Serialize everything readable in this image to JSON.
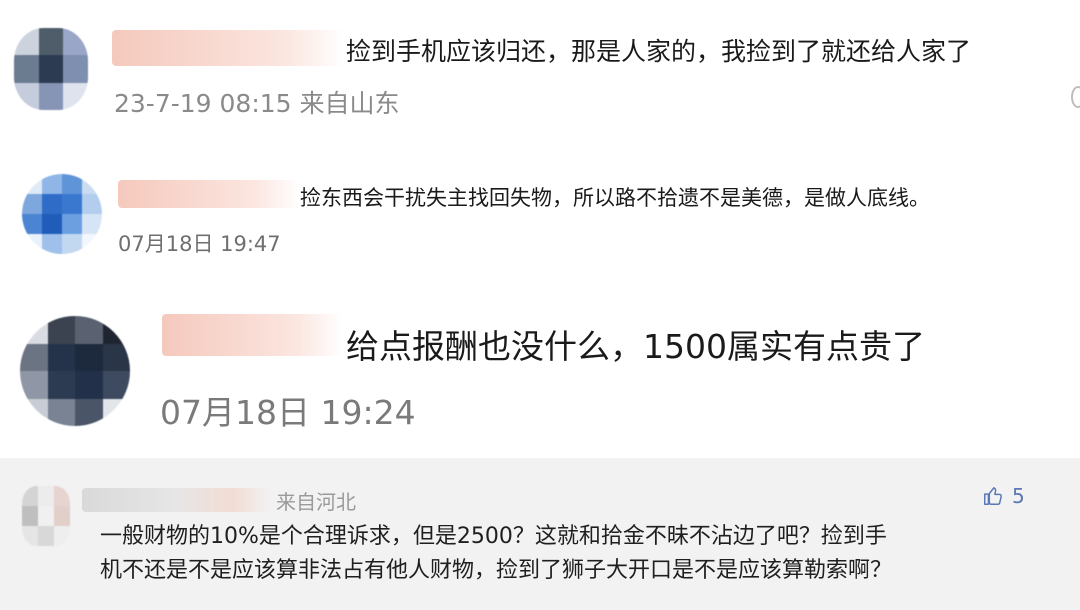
{
  "comments": [
    {
      "text": "捡到手机应该归还，那是人家的，我捡到了就还给人家了",
      "meta": "23-7-19 08:15 来自山东",
      "avatar_colors": [
        "#cdd3dc",
        "#4f5d6b",
        "#9aa6c8",
        "#6c7c90",
        "#2d3b52",
        "#7f8fb0",
        "#c5ccdc",
        "#8694b6",
        "#dfe3ee"
      ]
    },
    {
      "text": "捡东西会干扰失主找回失物，所以路不拾遗不是美德，是做人底线。",
      "meta": "07月18日 19:47",
      "avatar_colors": [
        "#dfeaf7",
        "#8fb6e6",
        "#5f94d8",
        "#c9dcf2",
        "#7ea7de",
        "#2f6cc8",
        "#3a78d0",
        "#b3cdef",
        "#4a84d2",
        "#1f5db8",
        "#6c9fe0",
        "#d6e5f6",
        "#e9f1fb",
        "#9ec0ea",
        "#c2d8f1",
        "#f2f7fd"
      ]
    },
    {
      "text": "给点报酬也没什么，1500属实有点贵了",
      "meta": "07月18日 19:24",
      "avatar_colors": [
        "#d9dde3",
        "#3b4350",
        "#5a6272",
        "#1f2530",
        "#6b7483",
        "#24324a",
        "#1d2a3e",
        "#2a3548",
        "#8f97a6",
        "#2c3a52",
        "#22304a",
        "#3d4a60",
        "#c8ccd4",
        "#7a8394",
        "#4b5568",
        "#e2e5ea"
      ]
    },
    {
      "region": "来自河北",
      "likes": "5",
      "body_lines": [
        "一般财物的10%是个合理诉求，但是2500？这就和拾金不昧不沾边了吧？捡到手",
        "机不还是不是应该算非法占有他人财物，捡到了狮子大开口是不是应该算勒索啊？"
      ],
      "avatar_colors": [
        "#d4d4d4",
        "#ececec",
        "#e7d3cf",
        "#bfbfbf",
        "#f0f0f0",
        "#e3cfca",
        "#e5e5e5",
        "#d8d8d8",
        "#eeeeee"
      ]
    }
  ],
  "icons": {
    "like": "thumbs-up-icon",
    "more": "more-icon"
  },
  "colors": {
    "background": "#ffffff",
    "footer_background": "#f2f2f2",
    "meta": "#8a8a8a",
    "like": "#5a78b4"
  }
}
